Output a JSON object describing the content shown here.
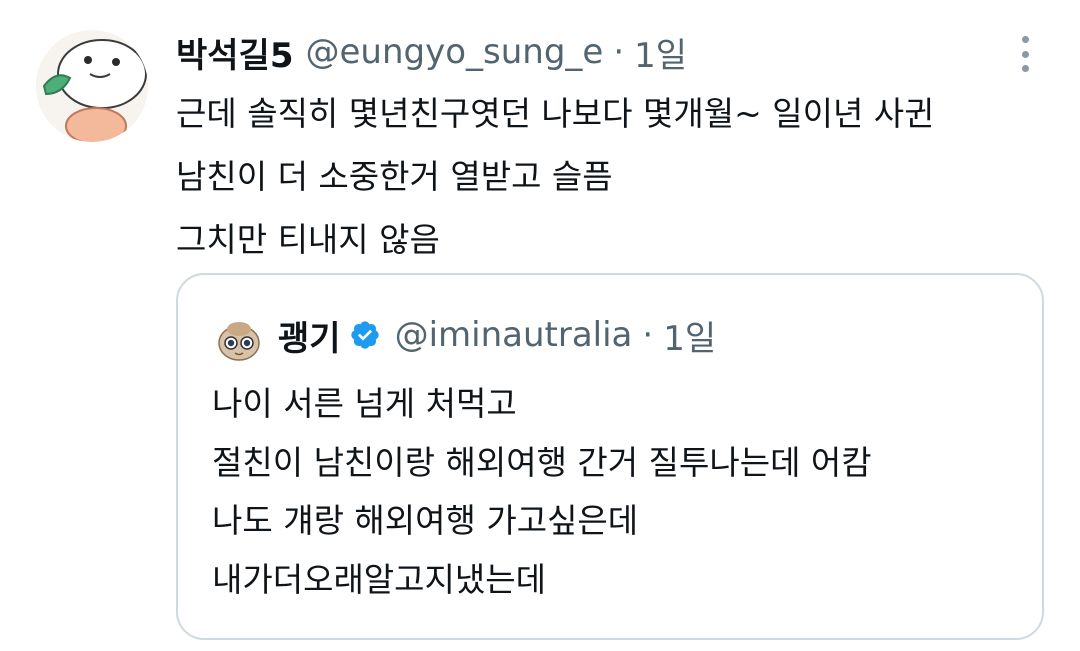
{
  "tweet": {
    "display_name": "박석길5",
    "handle": "@eungyo_sung_e",
    "separator": "·",
    "time": "1일",
    "more_icon": "more-options-icon",
    "lines": [
      "근데 솔직히 몇년친구엿던 나보다 몇개월~ 일이년 사귄",
      "남친이 더 소중한거 열받고 슬픔",
      "그치만 티내지 않음"
    ]
  },
  "quote": {
    "display_name": "괭기",
    "verified_icon": "verified-badge-icon",
    "handle": "@iminautralia",
    "separator": "·",
    "time": "1일",
    "lines": [
      "나이 서른 넘게 처먹고",
      "절친이 남친이랑 해외여행 간거 질투나는데 어캄",
      "나도 걔랑 해외여행 가고싶은데",
      "내가더오래알고지냈는데"
    ]
  },
  "colors": {
    "text_primary": "#0f1419",
    "text_secondary": "#536471",
    "border": "#cfd9de",
    "verified_blue": "#1d9bf0"
  }
}
